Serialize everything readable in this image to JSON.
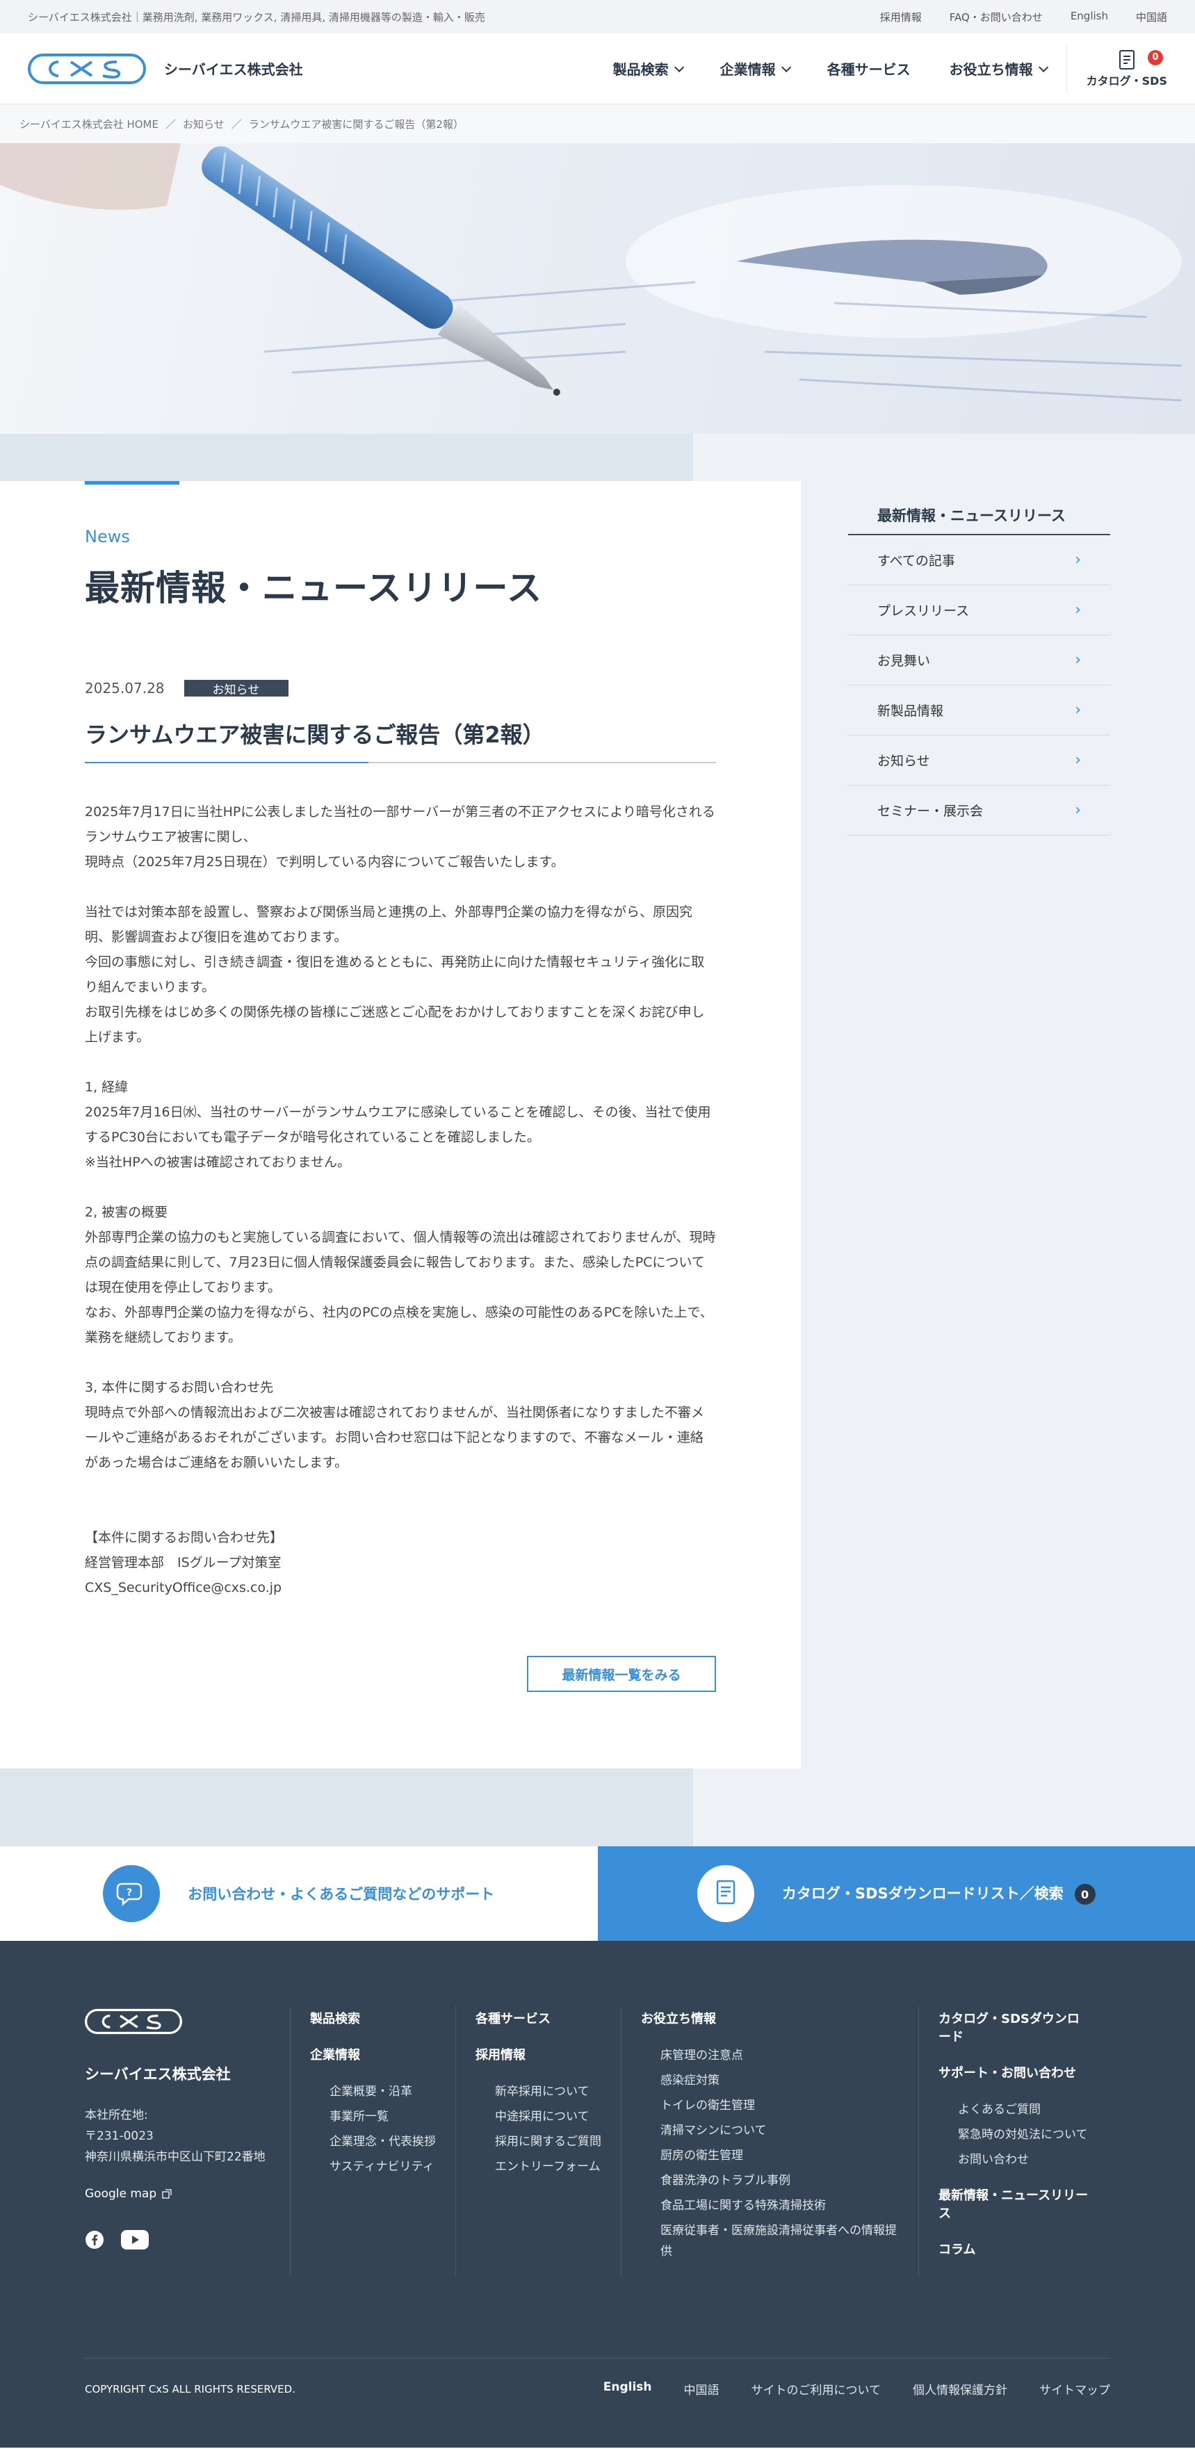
{
  "topbar": {
    "tagline": "シーバイエス株式会社｜業務用洗剤, 業務用ワックス, 清掃用具, 清掃用機器等の製造・輸入・販売",
    "links": [
      "採用情報",
      "FAQ・お問い合わせ",
      "English",
      "中国語"
    ]
  },
  "header": {
    "logo_text": "シーバイエス株式会社",
    "nav": [
      "製品検索",
      "企業情報",
      "各種サービス",
      "お役立ち情報"
    ],
    "catalog_label": "カタログ・SDS",
    "catalog_count": "0"
  },
  "breadcrumb": [
    "シーバイエス株式会社 HOME",
    "お知らせ",
    "ランサムウエア被害に関するご報告（第2報）"
  ],
  "article": {
    "section_label": "News",
    "page_title": "最新情報・ニュースリリース",
    "date": "2025.07.28",
    "tag": "お知らせ",
    "title": "ランサムウエア被害に関するご報告（第2報）",
    "paragraphs": [
      "2025年7月17日に当社HPに公表しました当社の一部サーバーが第三者の不正アクセスにより暗号化されるランサムウエア被害に関し、\n現時点（2025年7月25日現在）で判明している内容についてご報告いたします。",
      "当社では対策本部を設置し、警察および関係当局と連携の上、外部専門企業の協力を得ながら、原因究明、影響調査および復旧を進めております。\n今回の事態に対し、引き続き調査・復旧を進めるとともに、再発防止に向けた情報セキュリティ強化に取り組んでまいります。\nお取引先様をはじめ多くの関係先様の皆様にご迷惑とご心配をおかけしておりますことを深くお詫び申し上げます。",
      "1, 経緯\n2025年7月16日㈬、当社のサーバーがランサムウエアに感染していることを確認し、その後、当社で使用するPC30台においても電子データが暗号化されていることを確認しました。\n※当社HPへの被害は確認されておりません。",
      "2, 被害の概要\n外部専門企業の協力のもと実施している調査において、個人情報等の流出は確認されておりませんが、現時点の調査結果に則して、7月23日に個人情報保護委員会に報告しております。また、感染したPCについては現在使用を停止しております。\nなお、外部専門企業の協力を得ながら、社内のPCの点検を実施し、感染の可能性のあるPCを除いた上で、業務を継続しております。",
      "3, 本件に関するお問い合わせ先\n現時点で外部への情報流出および二次被害は確認されておりませんが、当社関係者になりすました不審メールやご連絡があるおそれがございます。お問い合わせ窓口は下記となりますので、不審なメール・連絡があった場合はご連絡をお願いいたします。",
      "【本件に関するお問い合わせ先】\n経営管理本部　ISグループ対策室\nCXS_SecurityOffice@cxs.co.jp"
    ],
    "back_button": "最新情報一覧をみる"
  },
  "sidebar": {
    "heading": "最新情報・ニュースリリース",
    "items": [
      "すべての記事",
      "プレスリリース",
      "お見舞い",
      "新製品情報",
      "お知らせ",
      "セミナー・展示会"
    ]
  },
  "support": {
    "left_label": "お問い合わせ・よくあるご質問などのサポート",
    "right_label": "カタログ・SDSダウンロードリスト／検索",
    "right_count": "0"
  },
  "footer": {
    "company": "シーバイエス株式会社",
    "address_label": "本社所在地:",
    "postal": "〒231-0023",
    "address": "神奈川県横浜市中区山下町22番地",
    "map_link": "Google map",
    "col1": {
      "h1": "製品検索",
      "h2": "企業情報",
      "items": [
        "企業概要・沿革",
        "事業所一覧",
        "企業理念・代表挨拶",
        "サスティナビリティ"
      ]
    },
    "col2": {
      "h1": "各種サービス",
      "h2": "採用情報",
      "items": [
        "新卒採用について",
        "中途採用について",
        "採用に関するご質問",
        "エントリーフォーム"
      ]
    },
    "col3": {
      "h1": "お役立ち情報",
      "items": [
        "床管理の注意点",
        "感染症対策",
        "トイレの衛生管理",
        "清掃マシンについて",
        "厨房の衛生管理",
        "食器洗浄のトラブル事例",
        "食品工場に関する特殊清掃技術",
        "医療従事者・医療施設清掃従事者への情報提供"
      ]
    },
    "col4": {
      "h1": "カタログ・SDSダウンロード",
      "h2": "サポート・お問い合わせ",
      "items": [
        "よくあるご質問",
        "緊急時の対処法について",
        "お問い合わせ"
      ],
      "h3": "最新情報・ニュースリリース",
      "h4": "コラム"
    },
    "copyright": "COPYRIGHT CxS ALL RIGHTS RESERVED.",
    "bottom_links": [
      "English",
      "中国語",
      "サイトのご利用について",
      "個人情報保護方針",
      "サイトマップ"
    ]
  },
  "colors": {
    "accent": "#3a8fd8",
    "footer_bg": "#344454",
    "badge": "#e53935"
  }
}
